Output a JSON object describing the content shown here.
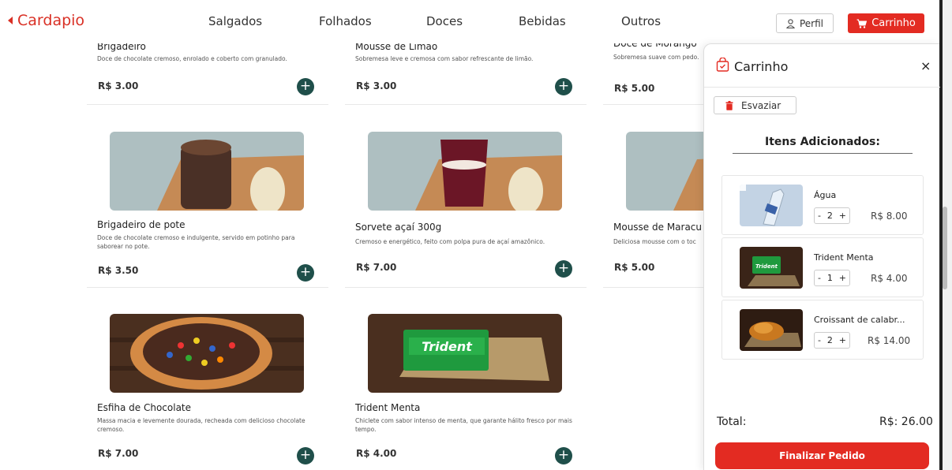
{
  "nav": {
    "brand": "Cardapio",
    "links": [
      "Salgados",
      "Folhados",
      "Doces",
      "Bebidas",
      "Outros"
    ],
    "perfil_label": "Perfil",
    "carrinho_label": "Carrinho"
  },
  "products": [
    {
      "name": "Brigadeiro",
      "desc": "Doce de chocolate cremoso, enrolado e coberto com granulado.",
      "price": "R$ 3.00"
    },
    {
      "name": "Mousse de Limão",
      "desc": "Sobremesa leve e cremosa com sabor refrescante de limão.",
      "price": "R$ 3.00"
    },
    {
      "name": "Doce de Morango",
      "desc": "Sobremesa suave com pedo.",
      "price": "R$ 5.00"
    },
    {
      "name": "Brigadeiro de pote",
      "desc": "Doce de chocolate cremoso e indulgente, servido em potinho para saborear no pote.",
      "price": "R$ 3.50"
    },
    {
      "name": "Sorvete açaí 300g",
      "desc": "Cremoso e energético, feito com polpa pura de açaí amazônico.",
      "price": "R$ 7.00"
    },
    {
      "name": "Mousse de Maracu",
      "desc": "Deliciosa mousse com o toc",
      "price": "R$ 5.00"
    },
    {
      "name": "Esfiha de Chocolate",
      "desc": "Massa macia e levemente dourada, recheada com delicioso chocolate cremoso.",
      "price": "R$ 7.00"
    },
    {
      "name": "Trident Menta",
      "desc": "Chiclete com sabor intenso de menta, que garante hálito fresco por mais tempo.",
      "price": "R$ 4.00"
    }
  ],
  "cart": {
    "title": "Carrinho",
    "close": "×",
    "empty_label": "Esvaziar",
    "items_title": "Itens Adicionados:",
    "items": [
      {
        "name": "Água",
        "qty": "2",
        "price": "R$ 8.00"
      },
      {
        "name": "Trident Menta",
        "qty": "1",
        "price": "R$ 4.00"
      },
      {
        "name": "Croissant de calabr...",
        "qty": "2",
        "price": "R$ 14.00"
      }
    ],
    "total_label": "Total:",
    "total_value": "R$: 26.00",
    "finish_label": "Finalizar Pedido"
  },
  "colors": {
    "accent": "#e32b22",
    "add_button": "#1f4f4a"
  }
}
